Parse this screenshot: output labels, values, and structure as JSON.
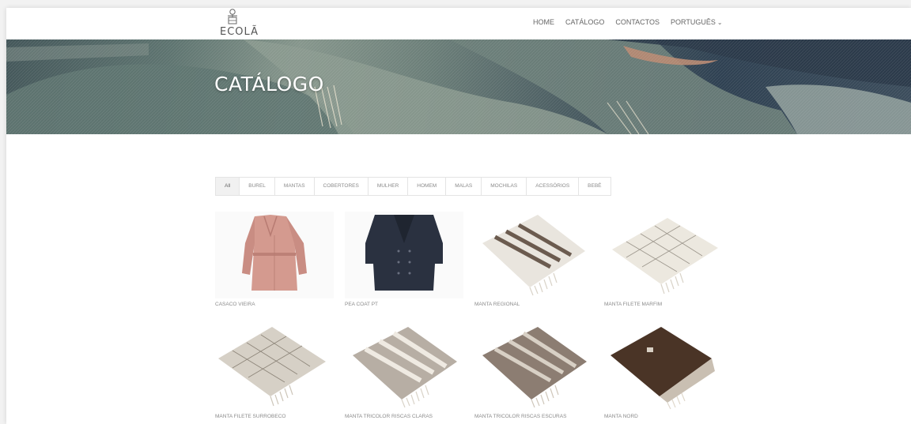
{
  "header": {
    "logo_text": "ECOLÃ",
    "nav": [
      "HOME",
      "CATÁLOGO",
      "CONTACTOS",
      "PORTUGUÊS"
    ]
  },
  "hero": {
    "title": "CATÁLOGO"
  },
  "filters": [
    "All",
    "BUREL",
    "MANTAS",
    "COBERTORES",
    "MULHER",
    "HOMEM",
    "MALAS",
    "MOCHILAS",
    "ACESSÓRIOS",
    "BEBÉ"
  ],
  "products": [
    {
      "name": "CASACO VIEIRA",
      "icon": "pink-coat-image"
    },
    {
      "name": "PEA COAT PT",
      "icon": "navy-coat-image"
    },
    {
      "name": "MANTA REGIONAL",
      "icon": "striped-blanket-image"
    },
    {
      "name": "MANTA FILETE MARFIM",
      "icon": "checked-blanket-image"
    },
    {
      "name": "MANTA FILETE SURROBECO",
      "icon": "checked-blanket-image"
    },
    {
      "name": "MANTA TRICOLOR RISCAS CLARAS",
      "icon": "striped-blanket-image"
    },
    {
      "name": "MANTA TRICOLOR RISCAS ESCURAS",
      "icon": "striped-blanket-image"
    },
    {
      "name": "MANTA NORD",
      "icon": "brown-blanket-image"
    }
  ],
  "colors": {
    "hero_dark": "#2f4152",
    "hero_teal": "#5e7470",
    "text": "#777777"
  }
}
